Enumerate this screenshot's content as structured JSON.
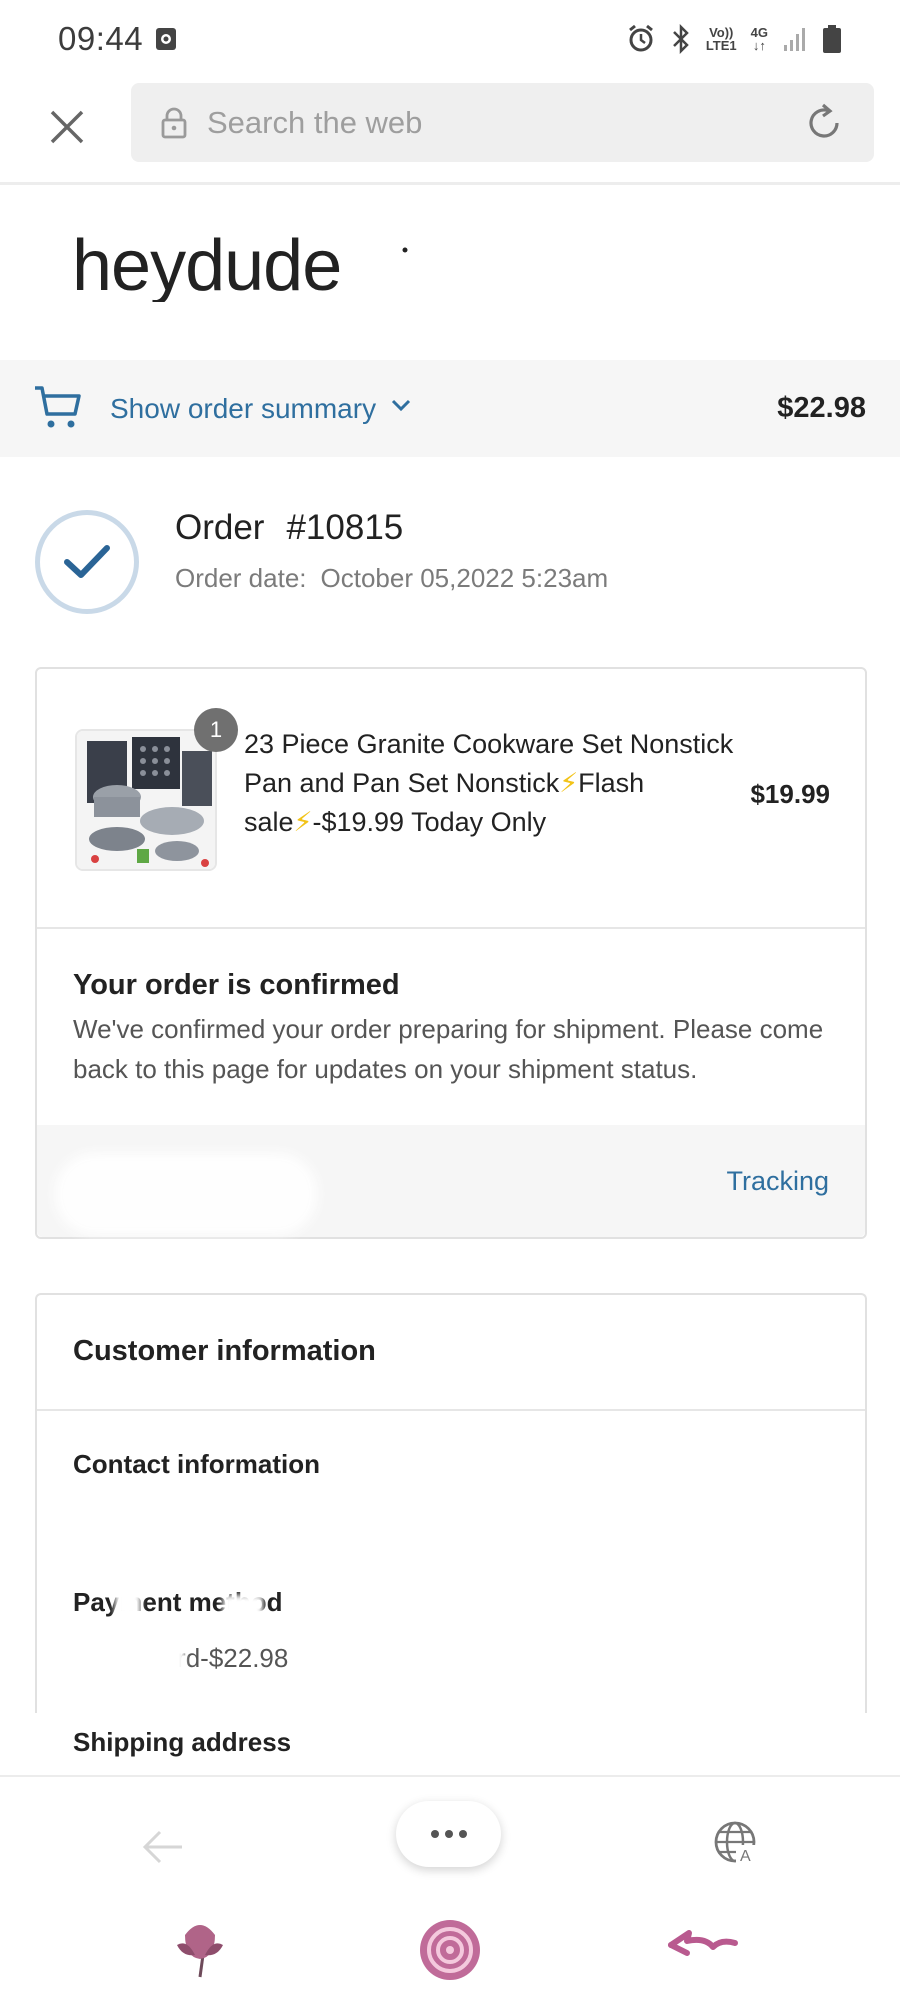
{
  "status_bar": {
    "time": "09:44",
    "network_top": "Vo))",
    "network_bottom": "LTE1",
    "signal_type": "4G"
  },
  "browser": {
    "search_placeholder": "Search the web"
  },
  "brand": {
    "logo_text": "heydude"
  },
  "order_summary": {
    "link_label": "Show order summary",
    "total": "$22.98"
  },
  "order": {
    "label": "Order",
    "number": "#10815",
    "date_label": "Order date:",
    "date_value": "October 05,2022 5:23am"
  },
  "product": {
    "quantity": "1",
    "name_part1": "23 Piece Granite Cookware Set Nonstick Pan and Pan Set Nonstick",
    "name_part2": "Flash sale",
    "name_part3": "-$19.99 Today Only",
    "price": "$19.99"
  },
  "confirmation": {
    "title": "Your order is confirmed",
    "message": "We've confirmed your order preparing for shipment. Please come back to this page for updates on your shipment status.",
    "tracking_label": "Tracking"
  },
  "customer_info": {
    "title": "Customer information",
    "contact_label": "Contact information",
    "payment_label": "Payment method",
    "payment_value": "Credit card-$22.98",
    "shipping_label": "Shipping address"
  },
  "colors": {
    "link_blue": "#2f6f9f",
    "check_blue": "#2a6496",
    "flower_pink": "#c06b99"
  }
}
